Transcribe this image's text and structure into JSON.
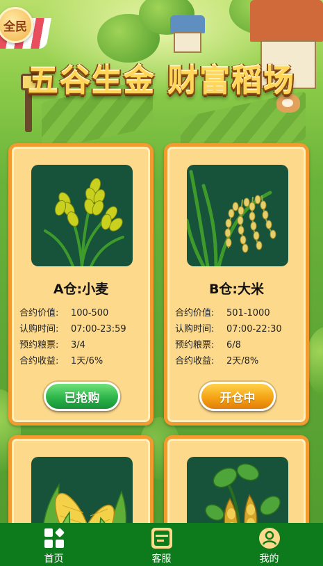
{
  "badge": "全民",
  "title": "五谷生金 财富稻场",
  "cards": [
    {
      "name": "A仓:小麦",
      "image_icon": "wheat-icon",
      "rows": [
        {
          "label": "合约价值:",
          "value": "100-500"
        },
        {
          "label": "认购时间:",
          "value": "07:00-23:59"
        },
        {
          "label": "预约粮票:",
          "value": "3/4"
        },
        {
          "label": "合约收益:",
          "value": "1天/6%"
        }
      ],
      "button": "已抢购",
      "button_color": "#2db54a"
    },
    {
      "name": "B仓:大米",
      "image_icon": "rice-icon",
      "rows": [
        {
          "label": "合约价值:",
          "value": "501-1000"
        },
        {
          "label": "认购时间:",
          "value": "07:00-22:30"
        },
        {
          "label": "预约粮票:",
          "value": "6/8"
        },
        {
          "label": "合约收益:",
          "value": "2天/8%"
        }
      ],
      "button": "开仓中",
      "button_color": "#f5a315"
    },
    {
      "image_icon": "corn-icon"
    },
    {
      "image_icon": "soybean-icon"
    }
  ],
  "nav": [
    {
      "label": "首页",
      "icon": "home-grid-icon"
    },
    {
      "label": "客服",
      "icon": "customer-service-icon"
    },
    {
      "label": "我的",
      "icon": "user-icon"
    }
  ],
  "colors": {
    "card_bg": "#fdd98b",
    "card_border": "#f29b2f",
    "image_bg": "#16533a",
    "nav_bg": "#0d7a1c",
    "title": "#ffd658"
  }
}
